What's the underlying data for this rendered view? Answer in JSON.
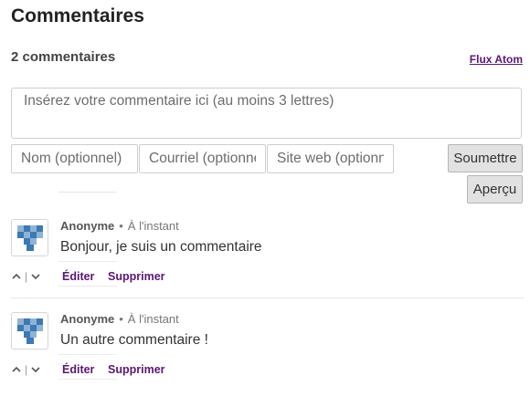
{
  "header": {
    "title": "Commentaires",
    "count": "2 commentaires",
    "feed_link": "Flux Atom"
  },
  "form": {
    "comment_placeholder": "Insérez votre commentaire ici (au moins 3 lettres)",
    "name_placeholder": "Nom (optionnel)",
    "email_placeholder": "Courriel (optionnel)",
    "website_placeholder": "Site web (optionnel)",
    "submit_label": "Soumettre",
    "preview_label": "Aperçu"
  },
  "comments": [
    {
      "author": "Anonyme",
      "time": "À l'instant",
      "text": "Bonjour, je suis un commentaire",
      "edit_label": "Éditer",
      "delete_label": "Supprimer",
      "avatar_icon": "identicon-avatar-icon"
    },
    {
      "author": "Anonyme",
      "time": "À l'instant",
      "text": "Un autre commentaire !",
      "edit_label": "Éditer",
      "delete_label": "Supprimer",
      "avatar_icon": "identicon-avatar-icon"
    }
  ],
  "colors": {
    "link": "#5b1675",
    "avatar_light": "#8fb3d5",
    "avatar_dark": "#3c79b6"
  }
}
